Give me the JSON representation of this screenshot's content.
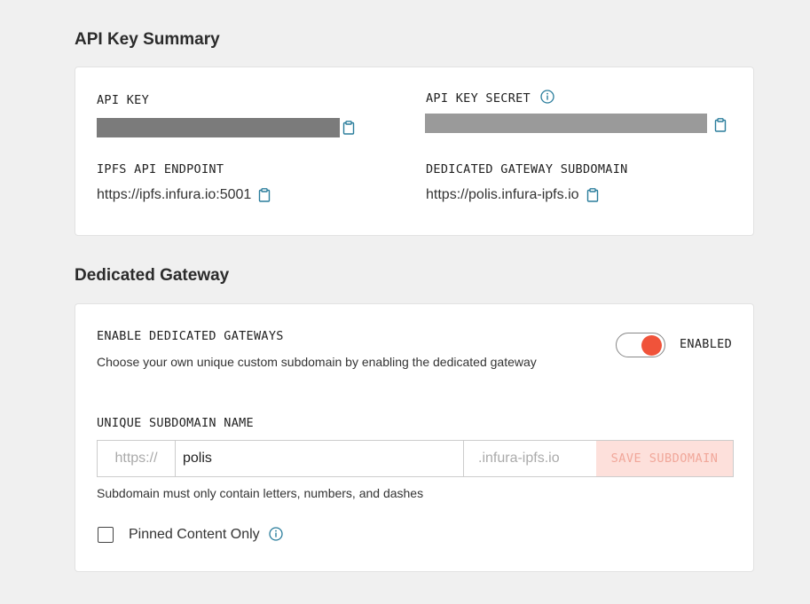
{
  "api_key_summary": {
    "title": "API Key Summary",
    "api_key_label": "API KEY",
    "api_key_secret_label": "API KEY SECRET",
    "ipfs_endpoint_label": "IPFS API ENDPOINT",
    "ipfs_endpoint_value": "https://ipfs.infura.io:5001",
    "gateway_subdomain_label": "DEDICATED GATEWAY SUBDOMAIN",
    "gateway_subdomain_value": "https://polis.infura-ipfs.io"
  },
  "dedicated_gateway": {
    "title": "Dedicated Gateway",
    "enable_label": "ENABLE DEDICATED GATEWAYS",
    "enable_description": "Choose your own unique custom subdomain by enabling the dedicated gateway",
    "toggle_state_label": "ENABLED",
    "toggle_on": true,
    "subdomain_label": "UNIQUE SUBDOMAIN NAME",
    "subdomain_prefix": "https://",
    "subdomain_value": "polis",
    "subdomain_suffix": ".infura-ipfs.io",
    "save_button_label": "SAVE SUBDOMAIN",
    "subdomain_hint": "Subdomain must only contain letters, numbers, and dashes",
    "pinned_only_label": "Pinned Content Only",
    "pinned_only_checked": false
  },
  "colors": {
    "accent": "#f0533a",
    "icon": "#2a7d9c",
    "masked_dark": "#7b7b7b",
    "masked_light": "#9a9a9a"
  },
  "icons": {
    "copy": "clipboard-icon",
    "info": "info-icon"
  }
}
